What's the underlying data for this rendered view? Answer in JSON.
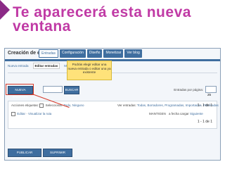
{
  "slide": {
    "title": "Te aparecerá esta nueva ventana"
  },
  "app": {
    "page_title": "Creación de entradas",
    "top_tabs": [
      {
        "label": "Entradas",
        "active": true
      },
      {
        "label": "Configuración",
        "active": false
      },
      {
        "label": "Diseño",
        "active": false
      },
      {
        "label": "Monetizar",
        "active": false
      },
      {
        "label": "Ver blog",
        "active": false
      }
    ],
    "sub_tabs": [
      {
        "label": "Nueva entrada",
        "active": false
      },
      {
        "label": "Editar entradas",
        "active": true
      },
      {
        "label": "Moderación de comentarios",
        "active": false
      }
    ],
    "new_post_button": "NUEVA ENTRADA",
    "search_button": "BUSCAR",
    "per_page_label": "Entradas por página:",
    "per_page_value": "25",
    "table": {
      "actions_label": "Acciones etiquetas:",
      "select_label": "Seleccionar:",
      "select_options": "Todo, Ninguno",
      "filter_label": "Ver entradas:",
      "filter_options": "Todas, Borradores, Programadas, Importadas, Publicadas",
      "count_top": "1 - 1 de 1",
      "row": {
        "edit_link": "Editar",
        "view_link": "Visualizar",
        "title": "la ruta",
        "user": "MANTIGEN",
        "date": "a fecha cargar",
        "status": "Siguiente"
      }
    },
    "count_bottom": "1 - 1 de 1",
    "publish_button": "PUBLICAR SELECCIONADOS",
    "delete_button": "SUPRIMIR SELECCIÓN"
  },
  "tooltip": {
    "text": "Podrás elegir editar una nueva entrada o editar una ya existente"
  },
  "colors": {
    "title": "#c03aa5",
    "accent_blue": "#3f6e9f",
    "highlight_red": "#d63a2a",
    "tooltip_yellow": "#ffe27a"
  }
}
